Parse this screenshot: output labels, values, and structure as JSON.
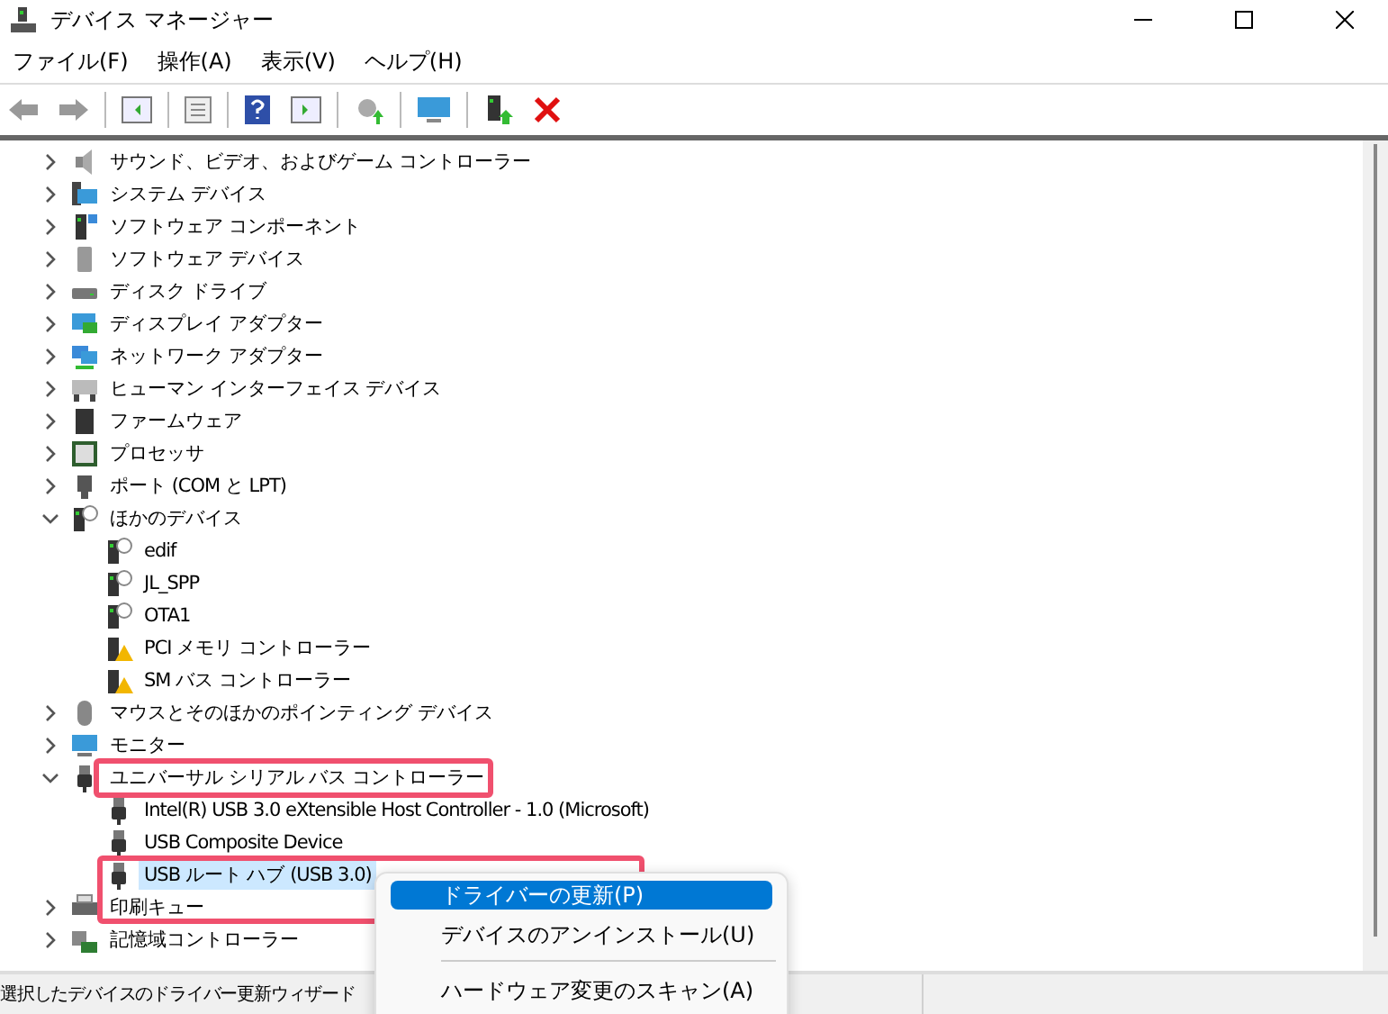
{
  "window": {
    "title": "デバイス マネージャー"
  },
  "menu": [
    "ファイル(F)",
    "操作(A)",
    "表示(V)",
    "ヘルプ(H)"
  ],
  "tree": [
    {
      "label": "サウンド、ビデオ、およびゲーム コントローラー",
      "kind": "speaker",
      "expanded": false,
      "selected": false
    },
    {
      "label": "システム デバイス",
      "kind": "system",
      "expanded": false,
      "selected": false
    },
    {
      "label": "ソフトウェア コンポーネント",
      "kind": "component",
      "expanded": false,
      "selected": false
    },
    {
      "label": "ソフトウェア デバイス",
      "kind": "tower",
      "expanded": false,
      "selected": false
    },
    {
      "label": "ディスク ドライブ",
      "kind": "disk",
      "expanded": false,
      "selected": false
    },
    {
      "label": "ディスプレイ アダプター",
      "kind": "display",
      "expanded": false,
      "selected": false
    },
    {
      "label": "ネットワーク アダプター",
      "kind": "network",
      "expanded": false,
      "selected": false
    },
    {
      "label": "ヒューマン インターフェイス デバイス",
      "kind": "keyboard",
      "expanded": false,
      "selected": false
    },
    {
      "label": "ファームウェア",
      "kind": "chip",
      "expanded": false,
      "selected": false
    },
    {
      "label": "プロセッサ",
      "kind": "cpu",
      "expanded": false,
      "selected": false
    },
    {
      "label": "ポート (COM と LPT)",
      "kind": "port",
      "expanded": false,
      "selected": false
    },
    {
      "label": "ほかのデバイス",
      "kind": "unknown",
      "expanded": true,
      "selected": false,
      "children": [
        {
          "label": "edif",
          "kind": "unknown",
          "selected": false
        },
        {
          "label": "JL_SPP",
          "kind": "unknown",
          "selected": false
        },
        {
          "label": "OTA1",
          "kind": "unknown",
          "selected": false
        },
        {
          "label": "PCI メモリ コントローラー",
          "kind": "warning",
          "selected": false
        },
        {
          "label": "SM バス コントローラー",
          "kind": "warning",
          "selected": false
        }
      ]
    },
    {
      "label": "マウスとそのほかのポインティング デバイス",
      "kind": "mouse",
      "expanded": false,
      "selected": false
    },
    {
      "label": "モニター",
      "kind": "monitor",
      "expanded": false,
      "selected": false
    },
    {
      "label": "ユニバーサル シリアル バス コントローラー",
      "kind": "usb",
      "expanded": true,
      "selected": false,
      "highlighted": true,
      "children": [
        {
          "label": "Intel(R) USB 3.0 eXtensible Host Controller - 1.0 (Microsoft)",
          "kind": "usb",
          "selected": false
        },
        {
          "label": "USB Composite Device",
          "kind": "usb",
          "selected": false
        },
        {
          "label": "USB ルート ハブ (USB 3.0)",
          "kind": "usb",
          "selected": true,
          "highlighted": true
        }
      ]
    },
    {
      "label": "印刷キュー",
      "kind": "printer",
      "expanded": false,
      "selected": false
    },
    {
      "label": "記憶域コントローラー",
      "kind": "storage",
      "expanded": false,
      "selected": false
    }
  ],
  "context_menu": {
    "items": [
      {
        "label": "ドライバーの更新(P)",
        "selected": true
      },
      {
        "label": "デバイスのアンインストール(U)",
        "selected": false
      },
      {
        "label": "ハードウェア変更のスキャン(A)",
        "selected": false
      }
    ]
  },
  "status_bar": {
    "text": "選択したデバイスのドライバー更新ウィザード"
  }
}
